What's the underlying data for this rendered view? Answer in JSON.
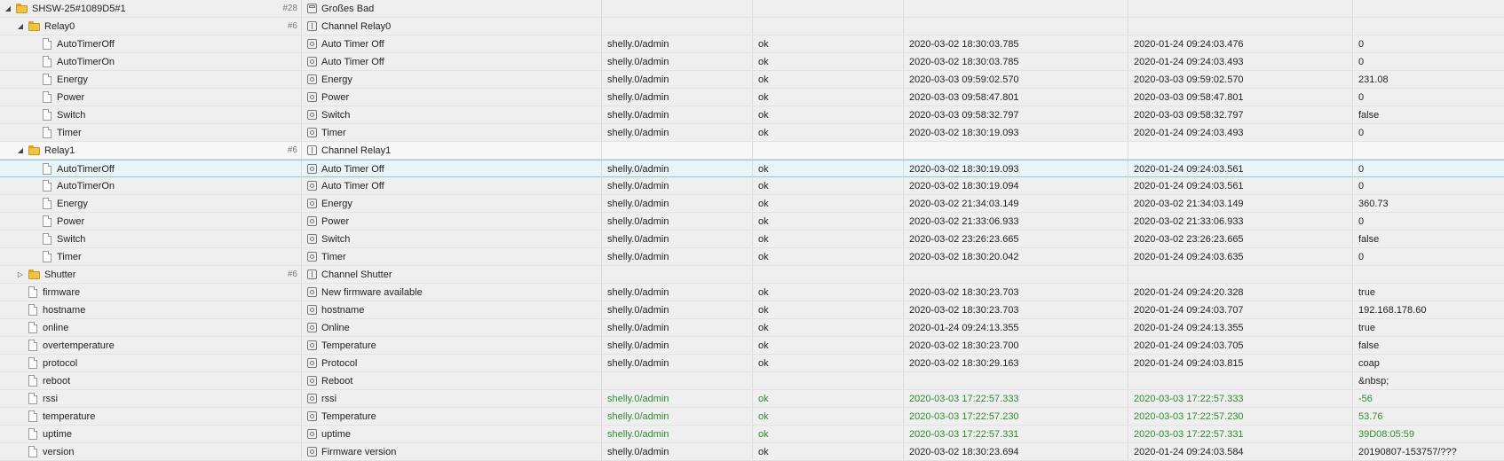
{
  "rows": [
    {
      "kind": "device",
      "level": 0,
      "expanded": true,
      "id": "SHSW-25#1089D5#1",
      "count": "#28",
      "name": "Großes Bad"
    },
    {
      "kind": "folder",
      "level": 1,
      "expanded": true,
      "id": "Relay0",
      "count": "#6",
      "name": "Channel Relay0"
    },
    {
      "kind": "state",
      "level": 2,
      "id": "AutoTimerOff",
      "name": "Auto Timer Off",
      "instance": "shelly.0/admin",
      "ack": "ok",
      "ts": "2020-03-02 18:30:03.785",
      "lc": "2020-01-24 09:24:03.476",
      "val": "0"
    },
    {
      "kind": "state",
      "level": 2,
      "id": "AutoTimerOn",
      "name": "Auto Timer Off",
      "instance": "shelly.0/admin",
      "ack": "ok",
      "ts": "2020-03-02 18:30:03.785",
      "lc": "2020-01-24 09:24:03.493",
      "val": "0"
    },
    {
      "kind": "state",
      "level": 2,
      "id": "Energy",
      "name": "Energy",
      "instance": "shelly.0/admin",
      "ack": "ok",
      "ts": "2020-03-03 09:59:02.570",
      "lc": "2020-03-03 09:59:02.570",
      "val": "231.08"
    },
    {
      "kind": "state",
      "level": 2,
      "id": "Power",
      "name": "Power",
      "instance": "shelly.0/admin",
      "ack": "ok",
      "ts": "2020-03-03 09:58:47.801",
      "lc": "2020-03-03 09:58:47.801",
      "val": "0"
    },
    {
      "kind": "state",
      "level": 2,
      "id": "Switch",
      "name": "Switch",
      "instance": "shelly.0/admin",
      "ack": "ok",
      "ts": "2020-03-03 09:58:32.797",
      "lc": "2020-03-03 09:58:32.797",
      "val": "false"
    },
    {
      "kind": "state",
      "level": 2,
      "id": "Timer",
      "name": "Timer",
      "instance": "shelly.0/admin",
      "ack": "ok",
      "ts": "2020-03-02 18:30:19.093",
      "lc": "2020-01-24 09:24:03.493",
      "val": "0"
    },
    {
      "kind": "folder",
      "level": 1,
      "expanded": true,
      "open": true,
      "id": "Relay1",
      "count": "#6",
      "name": "Channel Relay1"
    },
    {
      "kind": "state",
      "level": 2,
      "selected": true,
      "id": "AutoTimerOff",
      "name": "Auto Timer Off",
      "instance": "shelly.0/admin",
      "ack": "ok",
      "ts": "2020-03-02 18:30:19.093",
      "lc": "2020-01-24 09:24:03.561",
      "val": "0"
    },
    {
      "kind": "state",
      "level": 2,
      "id": "AutoTimerOn",
      "name": "Auto Timer Off",
      "instance": "shelly.0/admin",
      "ack": "ok",
      "ts": "2020-03-02 18:30:19.094",
      "lc": "2020-01-24 09:24:03.561",
      "val": "0"
    },
    {
      "kind": "state",
      "level": 2,
      "id": "Energy",
      "name": "Energy",
      "instance": "shelly.0/admin",
      "ack": "ok",
      "ts": "2020-03-02 21:34:03.149",
      "lc": "2020-03-02 21:34:03.149",
      "val": "360.73"
    },
    {
      "kind": "state",
      "level": 2,
      "id": "Power",
      "name": "Power",
      "instance": "shelly.0/admin",
      "ack": "ok",
      "ts": "2020-03-02 21:33:06.933",
      "lc": "2020-03-02 21:33:06.933",
      "val": "0"
    },
    {
      "kind": "state",
      "level": 2,
      "id": "Switch",
      "name": "Switch",
      "instance": "shelly.0/admin",
      "ack": "ok",
      "ts": "2020-03-02 23:26:23.665",
      "lc": "2020-03-02 23:26:23.665",
      "val": "false"
    },
    {
      "kind": "state",
      "level": 2,
      "id": "Timer",
      "name": "Timer",
      "instance": "shelly.0/admin",
      "ack": "ok",
      "ts": "2020-03-02 18:30:20.042",
      "lc": "2020-01-24 09:24:03.635",
      "val": "0"
    },
    {
      "kind": "folder",
      "level": 1,
      "expanded": false,
      "id": "Shutter",
      "count": "#6",
      "name": "Channel Shutter"
    },
    {
      "kind": "state",
      "level": 1,
      "id": "firmware",
      "name": "New firmware available",
      "instance": "shelly.0/admin",
      "ack": "ok",
      "ts": "2020-03-02 18:30:23.703",
      "lc": "2020-01-24 09:24:20.328",
      "val": "true"
    },
    {
      "kind": "state",
      "level": 1,
      "id": "hostname",
      "name": "hostname",
      "instance": "shelly.0/admin",
      "ack": "ok",
      "ts": "2020-03-02 18:30:23.703",
      "lc": "2020-01-24 09:24:03.707",
      "val": "192.168.178.60"
    },
    {
      "kind": "state",
      "level": 1,
      "id": "online",
      "name": "Online",
      "instance": "shelly.0/admin",
      "ack": "ok",
      "ts": "2020-01-24 09:24:13.355",
      "lc": "2020-01-24 09:24:13.355",
      "val": "true"
    },
    {
      "kind": "state",
      "level": 1,
      "id": "overtemperature",
      "name": "Temperature",
      "instance": "shelly.0/admin",
      "ack": "ok",
      "ts": "2020-03-02 18:30:23.700",
      "lc": "2020-01-24 09:24:03.705",
      "val": "false"
    },
    {
      "kind": "state",
      "level": 1,
      "id": "protocol",
      "name": "Protocol",
      "instance": "shelly.0/admin",
      "ack": "ok",
      "ts": "2020-03-02 18:30:29.163",
      "lc": "2020-01-24 09:24:03.815",
      "val": "coap"
    },
    {
      "kind": "state",
      "level": 1,
      "id": "reboot",
      "name": "Reboot",
      "instance": "",
      "ack": "",
      "ts": "",
      "lc": "",
      "val": "&nbsp;"
    },
    {
      "kind": "state",
      "level": 1,
      "green": true,
      "id": "rssi",
      "name": "rssi",
      "instance": "shelly.0/admin",
      "ack": "ok",
      "ts": "2020-03-03 17:22:57.333",
      "lc": "2020-03-03 17:22:57.333",
      "val": "-56"
    },
    {
      "kind": "state",
      "level": 1,
      "green": true,
      "id": "temperature",
      "name": "Temperature",
      "instance": "shelly.0/admin",
      "ack": "ok",
      "ts": "2020-03-03 17:22:57.230",
      "lc": "2020-03-03 17:22:57.230",
      "val": "53.76"
    },
    {
      "kind": "state",
      "level": 1,
      "green": true,
      "id": "uptime",
      "name": "uptime",
      "instance": "shelly.0/admin",
      "ack": "ok",
      "ts": "2020-03-03 17:22:57.331",
      "lc": "2020-03-03 17:22:57.331",
      "val": "39D08:05:59"
    },
    {
      "kind": "state",
      "level": 1,
      "id": "version",
      "name": "Firmware version",
      "instance": "shelly.0/admin",
      "ack": "ok",
      "ts": "2020-03-02 18:30:23.694",
      "lc": "2020-01-24 09:24:03.584",
      "val": "20190807-153757/???"
    }
  ]
}
